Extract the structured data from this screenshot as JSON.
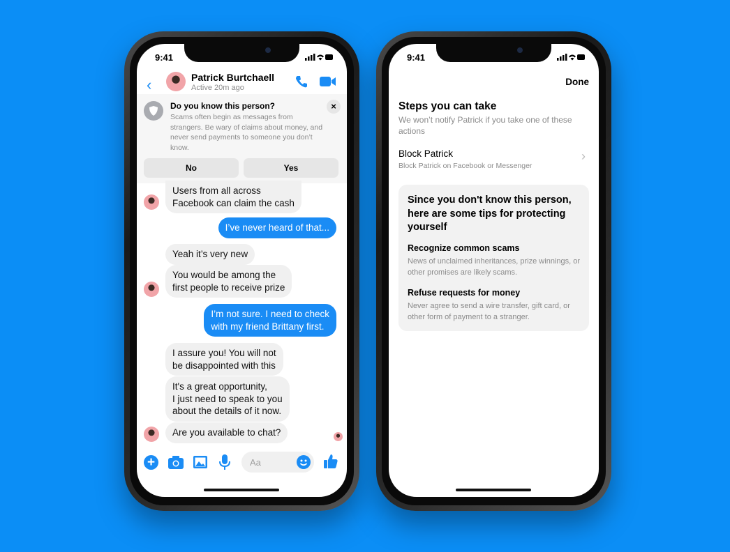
{
  "colors": {
    "background": "#0b8ef6",
    "accent": "#1a8cf5"
  },
  "status_bar": {
    "time": "9:41"
  },
  "chat": {
    "contact_name": "Patrick Burtchaell",
    "status": "Active 20m ago",
    "warning": {
      "title": "Do you know this person?",
      "body": "Scams often begin as messages from strangers. Be wary of claims about money, and never send payments to someone you don’t know.",
      "no_label": "No",
      "yes_label": "Yes"
    },
    "messages": [
      {
        "from": "them",
        "text": "Users from all across\nFacebook can claim the cash"
      },
      {
        "from": "me",
        "text": "I’ve never heard of that..."
      },
      {
        "from": "them",
        "text": "Yeah it’s very new"
      },
      {
        "from": "them",
        "text": "You would be among the\nfirst people to receive prize"
      },
      {
        "from": "me",
        "text": "I’m not sure. I need to check\nwith my friend Brittany first."
      },
      {
        "from": "them",
        "text": "I assure you! You will not\nbe disappointed with this"
      },
      {
        "from": "them",
        "text": "It's a great opportunity,\nI just need to speak to you\nabout the details of it now."
      },
      {
        "from": "them",
        "text": "Are you available to chat?"
      }
    ],
    "composer_placeholder": "Aa"
  },
  "steps": {
    "done_label": "Done",
    "title": "Steps you can take",
    "subtitle": "We won’t notify Patrick if you take one of these actions",
    "block_title": "Block Patrick",
    "block_subtitle": "Block Patrick on Facebook or Messenger",
    "tips_title": "Since you don't know this person, here are some tips for protecting yourself",
    "tips": [
      {
        "title": "Recognize common scams",
        "body": "News of unclaimed inheritances, prize winnings, or other promises are likely scams."
      },
      {
        "title": "Refuse requests for money",
        "body": "Never agree to send a wire transfer, gift card, or other form of payment to a stranger."
      }
    ]
  }
}
